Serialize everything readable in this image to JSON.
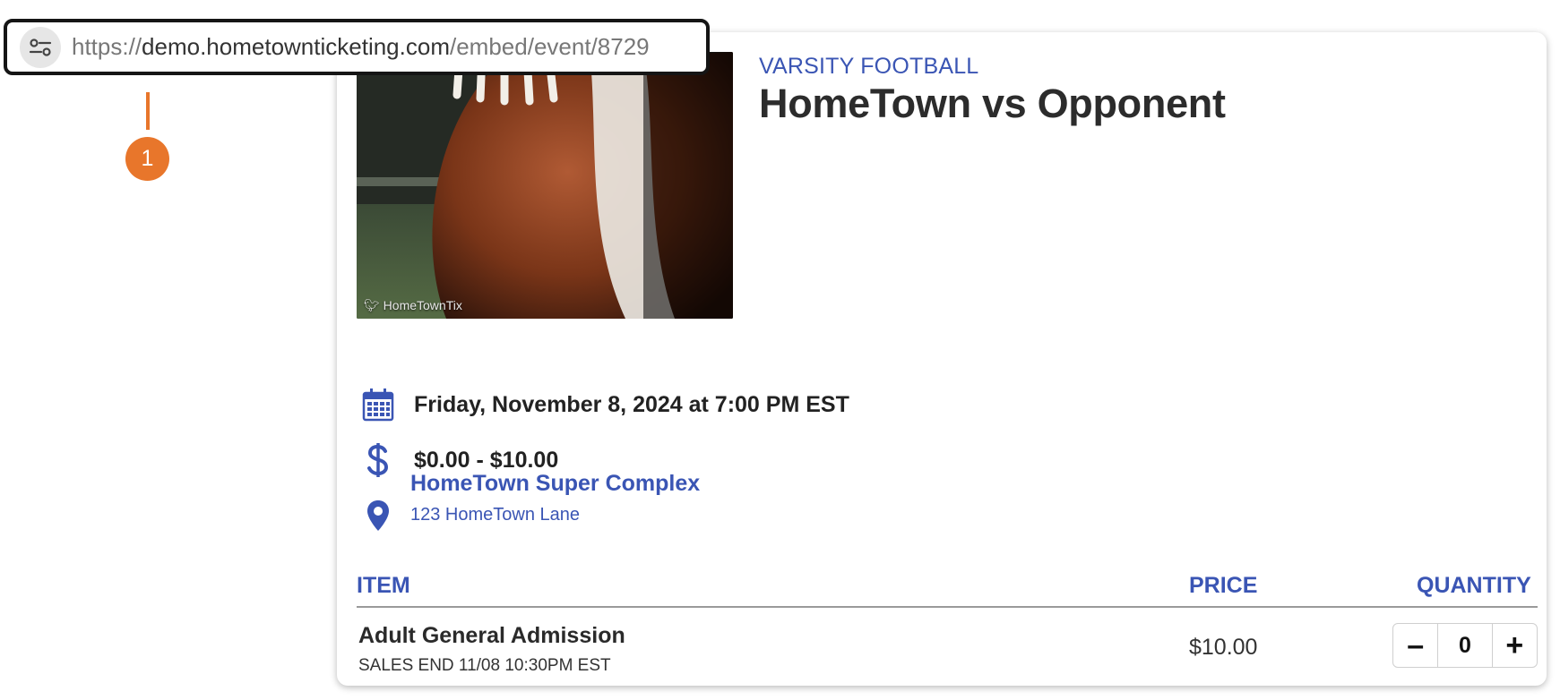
{
  "browser": {
    "url_scheme": "https://",
    "url_host": "demo.hometownticketing.com",
    "url_path": "/embed/event/8729"
  },
  "callout": {
    "number": "1",
    "color": "#e8762b"
  },
  "event": {
    "image_credit": "HomeTownTix",
    "category": "VARSITY FOOTBALL",
    "title": "HomeTown vs Opponent",
    "datetime": "Friday, November 8, 2024 at 7:00 PM EST",
    "price_range": "$0.00 - $10.00",
    "venue_name": "HomeTown Super Complex",
    "venue_address": "123 HomeTown Lane"
  },
  "table": {
    "headers": {
      "item": "ITEM",
      "price": "PRICE",
      "quantity": "QUANTITY"
    },
    "rows": [
      {
        "name": "Adult General Admission",
        "sales_end": "SALES END 11/08 10:30PM EST",
        "price": "$10.00",
        "quantity": "0",
        "decrement": "–",
        "increment": "+"
      }
    ]
  },
  "icons": {
    "calendar": "calendar-icon",
    "dollar": "dollar-icon",
    "location": "map-pin-icon",
    "site_settings": "tune-icon",
    "twitter": "twitter-bird-icon"
  },
  "colors": {
    "accent": "#3a55b4",
    "text": "#222222"
  }
}
